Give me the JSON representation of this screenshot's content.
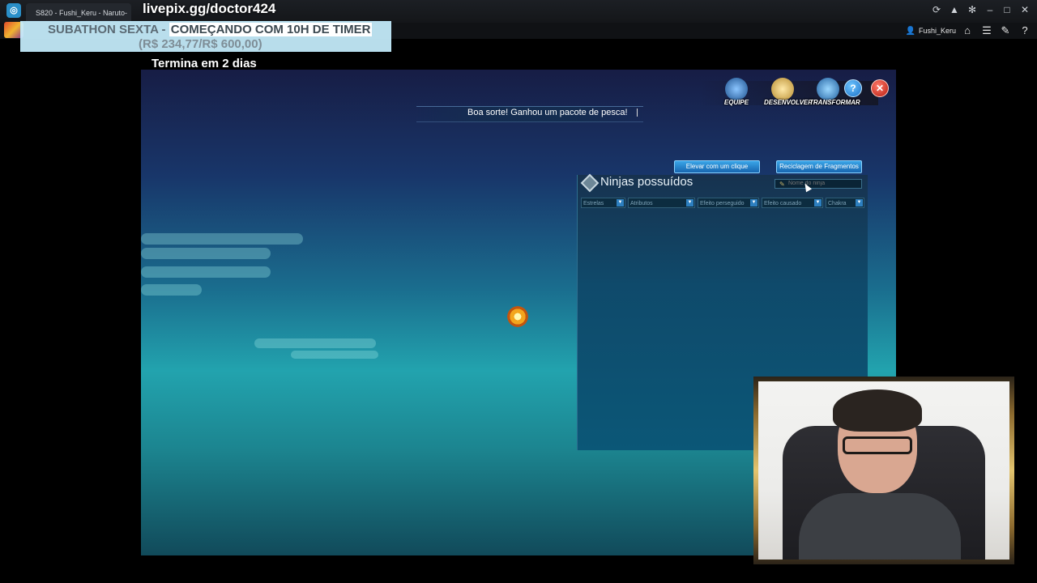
{
  "window": {
    "tab_title": "S820 - Fushi_Keru - Naruto-",
    "app_icon": "app-logo-icon",
    "controls": [
      "refresh-icon",
      "extension-icon",
      "settings-icon",
      "minimize-icon",
      "maximize-icon",
      "close-icon"
    ]
  },
  "toolbar": {
    "user_name": "Fushi_Keru",
    "icons": [
      "user-icon",
      "home-icon",
      "list-icon",
      "quill-icon",
      "help-icon"
    ]
  },
  "stream_overlay": {
    "link": "livepix.gg/doctor424",
    "banner_prefix": "SUBATHON SEXTA - ",
    "banner_highlight": "COMEÇANDO COM 10H DE TIMER",
    "banner_line2": "(R$ 234,77/R$ 600,00)",
    "countdown": "Termina em 2 dias"
  },
  "game": {
    "message": "Boa sorte! Ganhou um pacote de pesca!",
    "menu": [
      {
        "label": "EQUIPE",
        "icon": "team-icon"
      },
      {
        "label": "DESENVOLVER",
        "icon": "develop-icon"
      },
      {
        "label": "TRANSFORMAR",
        "icon": "transform-icon"
      }
    ],
    "panel": {
      "title": "Ninjas possuídos",
      "btn_elevate": "Elevar com um clique",
      "btn_recycle": "Reciclagem de Fragmentos",
      "search_placeholder": "Nome do ninja",
      "filters": [
        "Estrelas",
        "Atributos",
        "Efeito perseguido",
        "Efeito causado",
        "Chakra"
      ]
    }
  }
}
